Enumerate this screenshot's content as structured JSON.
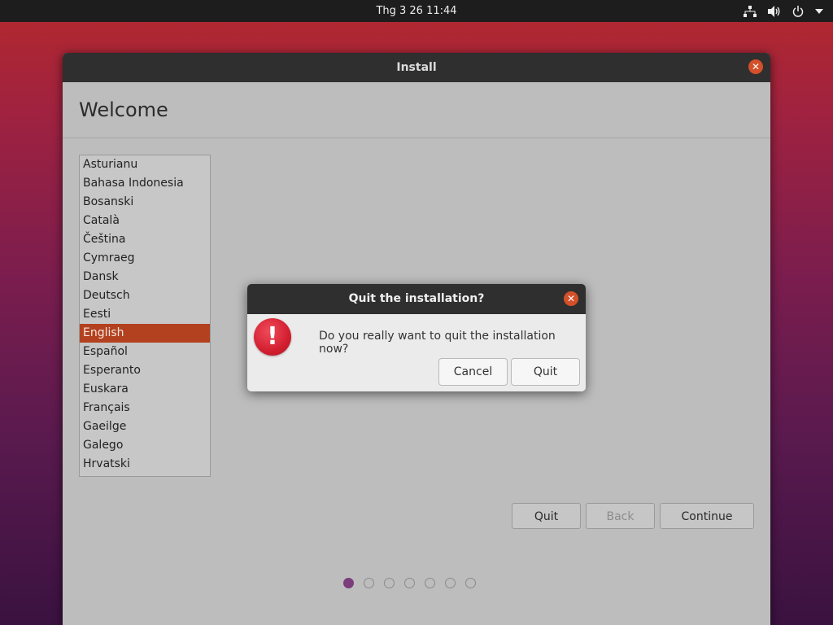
{
  "topbar": {
    "clock": "Thg 3 26  11:44",
    "icons": [
      "network-icon",
      "volume-icon",
      "power-icon",
      "menu-arrow-icon"
    ]
  },
  "window": {
    "title": "Install",
    "close_glyph": "✕",
    "heading": "Welcome",
    "languages": [
      "Asturianu",
      "Bahasa Indonesia",
      "Bosanski",
      "Català",
      "Čeština",
      "Cymraeg",
      "Dansk",
      "Deutsch",
      "Eesti",
      "English",
      "Español",
      "Esperanto",
      "Euskara",
      "Français",
      "Gaeilge",
      "Galego",
      "Hrvatski"
    ],
    "selected_language": "English",
    "buttons": {
      "quit": "Quit",
      "back": "Back",
      "continue": "Continue"
    },
    "progress": {
      "total_steps": 7,
      "current_step": 1
    }
  },
  "dialog": {
    "title": "Quit the installation?",
    "close_glyph": "✕",
    "icon_glyph": "!",
    "message": "Do you really want to quit the installation now?",
    "cancel_label": "Cancel",
    "quit_label": "Quit"
  },
  "colors": {
    "accent": "#b3411f",
    "close_button": "#d3502a",
    "error_icon": "#d21f30",
    "progress_active": "#7b3d7c"
  }
}
